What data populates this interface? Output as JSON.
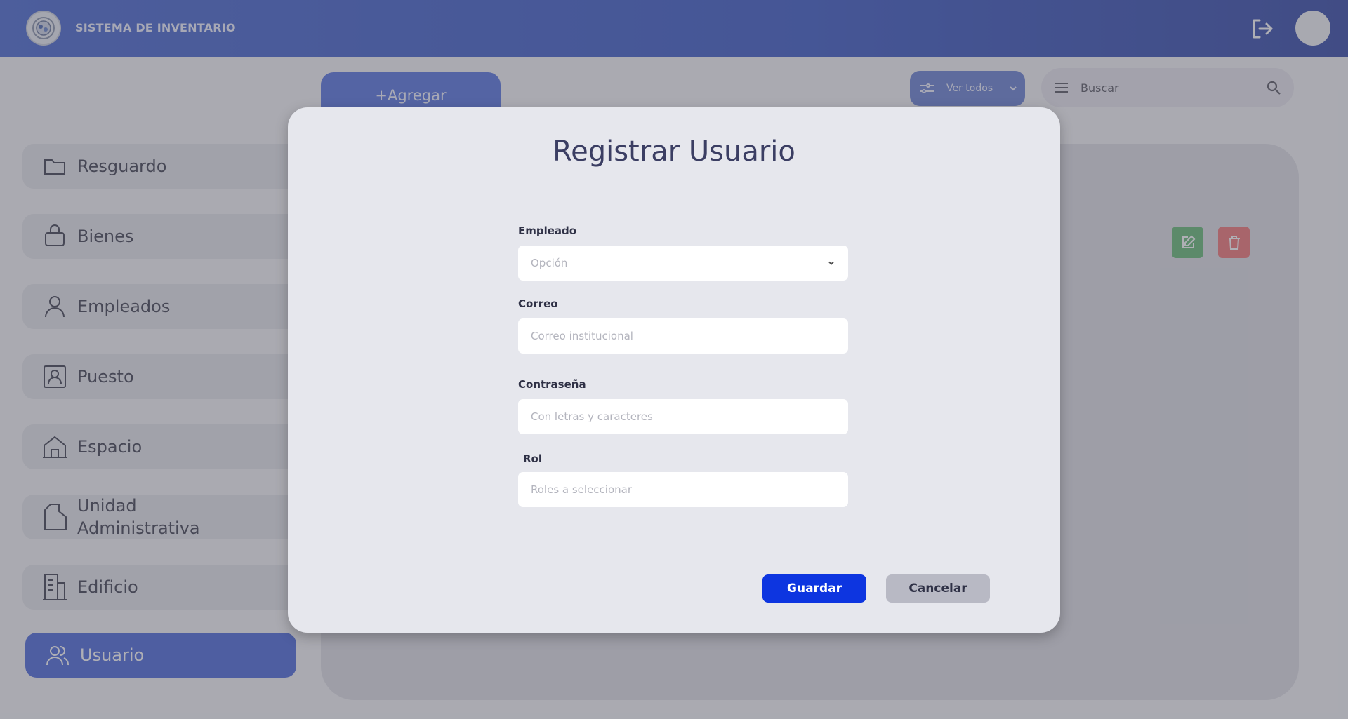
{
  "header": {
    "app_title": "SISTEMA DE INVENTARIO",
    "logo_icon": "seal-logo-icon",
    "logout_icon": "logout-icon",
    "avatar": "user-avatar"
  },
  "sidebar": {
    "items": [
      {
        "label": "Resguardo",
        "icon": "folder-icon"
      },
      {
        "label": "Bienes",
        "icon": "briefcase-icon"
      },
      {
        "label": "Empleados",
        "icon": "person-icon"
      },
      {
        "label": "Puesto",
        "icon": "id-badge-icon"
      },
      {
        "label": "Espacio",
        "icon": "house-icon"
      },
      {
        "label": "Unidad Administrativa",
        "icon": "document-icon"
      },
      {
        "label": "Edificio",
        "icon": "building-icon"
      },
      {
        "label": "Usuario",
        "icon": "users-icon",
        "active": true
      }
    ]
  },
  "toolbar": {
    "add_label": "+Agregar",
    "filter_label": "Ver todos",
    "search_placeholder": "Buscar"
  },
  "modal": {
    "title": "Registrar Usuario",
    "fields": {
      "empleado": {
        "label": "Empleado",
        "placeholder": "Opción"
      },
      "correo": {
        "label": "Correo",
        "placeholder": "Correo institucional"
      },
      "contrasena": {
        "label": "Contraseña",
        "placeholder": "Con letras y caracteres"
      },
      "rol": {
        "label": "Rol",
        "placeholder": "Roles a seleccionar"
      }
    },
    "save_label": "Guardar",
    "cancel_label": "Cancelar"
  },
  "colors": {
    "header": "#3a5ccc",
    "active_sidebar": "#3d5cd6",
    "save_button": "#0d35e0",
    "edit_button": "#58b468",
    "delete_button": "#f06b6b"
  }
}
